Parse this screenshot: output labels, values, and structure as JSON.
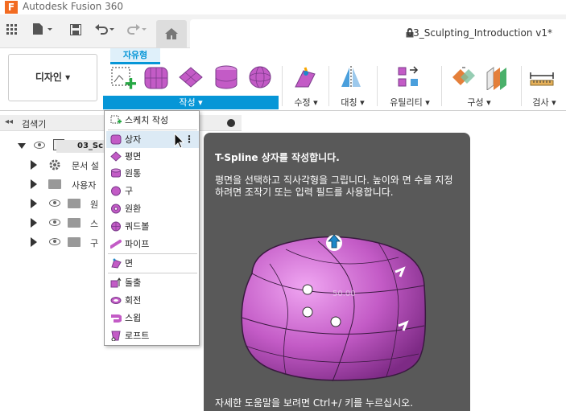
{
  "app": {
    "title": "Autodesk Fusion 360",
    "logo_letter": "F"
  },
  "document": {
    "title": "03_Sculpting_Introduction v1*"
  },
  "workspace": {
    "label": "디자인 ▾"
  },
  "ribbon": {
    "active_tab": "자유형",
    "groups": [
      {
        "label": "작성 ▾"
      },
      {
        "label": "수정 ▾"
      },
      {
        "label": "대칭 ▾"
      },
      {
        "label": "유틸리티 ▾"
      },
      {
        "label": "구성 ▾"
      },
      {
        "label": "검사 ▾"
      }
    ]
  },
  "browser": {
    "title": "검색기",
    "collapse_label": "◂◂",
    "rows": [
      {
        "label": "03_Sc"
      },
      {
        "label": "문서 설"
      },
      {
        "label": "사용자"
      },
      {
        "label": "원"
      },
      {
        "label": "스"
      },
      {
        "label": "구"
      }
    ]
  },
  "create_menu": {
    "items": [
      {
        "label": "스케치 작성",
        "icon": "sketch-icon"
      },
      {
        "label": "상자",
        "icon": "box-icon"
      },
      {
        "label": "평면",
        "icon": "plane-icon"
      },
      {
        "label": "원통",
        "icon": "cylinder-icon"
      },
      {
        "label": "구",
        "icon": "sphere-icon"
      },
      {
        "label": "원환",
        "icon": "torus-icon"
      },
      {
        "label": "쿼드볼",
        "icon": "quadball-icon"
      },
      {
        "label": "파이프",
        "icon": "pipe-icon"
      },
      {
        "label": "면",
        "icon": "face-icon"
      },
      {
        "label": "돌출",
        "icon": "extrude-icon"
      },
      {
        "label": "회전",
        "icon": "revolve-icon"
      },
      {
        "label": "스윕",
        "icon": "sweep-icon"
      },
      {
        "label": "로프트",
        "icon": "loft-icon"
      }
    ],
    "more_dots": "⋮"
  },
  "tooltip": {
    "title": "T-Spline 상자를 작성합니다.",
    "description": "평면을 선택하고 직사각형을 그립니다. 높이와 면 수를 지정하려면 조작기 또는 입력 필드를 사용합니다.",
    "dimension_label": "50.00",
    "help": "자세한 도움말을 보려면 Ctrl+/ 키를 누르십시오."
  },
  "colors": {
    "accent": "#0696d7",
    "tspline": "#c35bc6",
    "tooltip_bg": "#595959"
  }
}
